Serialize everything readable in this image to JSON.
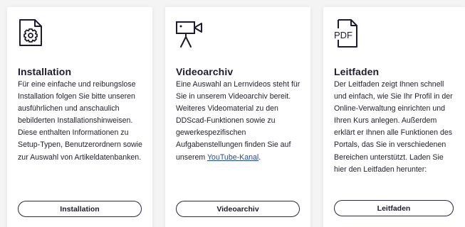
{
  "cards": [
    {
      "icon": "settings-document-icon",
      "title": "Installation",
      "text": "Für eine einfache und reibungslose Installation folgen Sie bitte unseren ausführlichen und anschaulich bebilderten Installationshinweisen. Diese enthalten Informationen zu Setup-Typen, Benutzerordnern sowie zur Auswahl von Artikeldatenbanken.",
      "button": "Installation"
    },
    {
      "icon": "video-camera-icon",
      "title": "Videoarchiv",
      "text_before_link": "Eine Auswahl an Lernvideos steht für Sie in unserem Videoarchiv bereit. Weiteres Videomaterial zu den DDScad-Funktionen sowie zu gewerkespezifischen Aufgabenstellungen finden Sie auf unserem ",
      "link": "YouTube-Kanal",
      "text_after_link": ".",
      "button": "Videoarchiv"
    },
    {
      "icon": "pdf-document-icon",
      "icon_label": "PDF",
      "title": "Leitfaden",
      "text": "Der Leitfaden zeigt Ihnen schnell und einfach, wie Sie Ihr Profil in der Online-Verwaltung einrichten und Ihren Kurs anlegen. Außerdem erklärt er Ihnen alle Funktionen des Portals, das Sie in verschiedenen Bereichen unterstützt. Laden Sie hier den Leitfaden herunter:",
      "button": "Leitfaden"
    }
  ],
  "colors": {
    "text": "#1c1c2e",
    "link": "#1f4aa0",
    "card_bg": "#ffffff",
    "page_bg": "#f4f4f5"
  }
}
